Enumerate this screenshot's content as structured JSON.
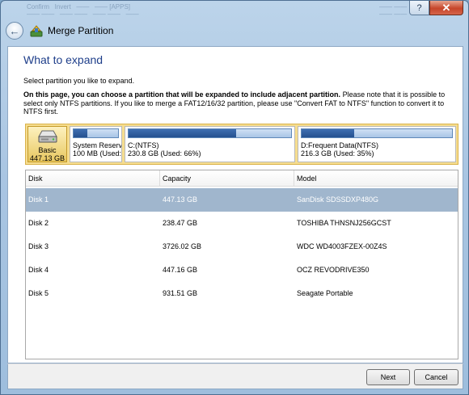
{
  "window": {
    "title": "Merge Partition",
    "bg_text_left": "Confirm   Invert   ——   —— [APPS]\n—— ——   —— ——   —— ——   ——",
    "bg_text_right": "—— ——   ——\n—— ——   ——",
    "controls": {
      "help": "?",
      "close": "✕"
    }
  },
  "page": {
    "heading": "What to expand",
    "subheading": "Select partition you like to expand.",
    "description_bold": "On this page, you can choose a partition that will be expanded to include adjacent partition.",
    "description_rest": " Please note that it is possible to select only NTFS partitions. If you like to merge a FAT12/16/32 partition, please use \"Convert FAT to NTFS\" function to convert it to NTFS first."
  },
  "disk_map": {
    "disk": {
      "type": "Basic",
      "size": "447.13 GB",
      "icon": "hard-drive-icon"
    },
    "partitions": [
      {
        "name": "System Reserv",
        "info": "100 MB (Used:",
        "used_fraction": 0.3
      },
      {
        "name": "C:(NTFS)",
        "info": "230.8 GB (Used: 66%)",
        "used_fraction": 0.66
      },
      {
        "name": "D:Frequent Data(NTFS)",
        "info": "216.3 GB (Used: 35%)",
        "used_fraction": 0.35
      }
    ]
  },
  "table": {
    "columns": [
      "Disk",
      "Capacity",
      "Model"
    ],
    "rows": [
      {
        "disk": "Disk 1",
        "capacity": "447.13 GB",
        "model": "SanDisk SDSSDXP480G",
        "selected": true
      },
      {
        "disk": "Disk 2",
        "capacity": "238.47 GB",
        "model": "TOSHIBA THNSNJ256GCST",
        "selected": false
      },
      {
        "disk": "Disk 3",
        "capacity": "3726.02 GB",
        "model": "WDC WD4003FZEX-00Z4S",
        "selected": false
      },
      {
        "disk": "Disk 4",
        "capacity": "447.16 GB",
        "model": "OCZ REVODRIVE350",
        "selected": false
      },
      {
        "disk": "Disk 5",
        "capacity": "931.51 GB",
        "model": "Seagate Portable",
        "selected": false
      }
    ]
  },
  "buttons": {
    "next": "Next",
    "cancel": "Cancel"
  },
  "colors": {
    "selection": "#a0b6cd",
    "heading": "#1e3e8a",
    "disk_strip": "#f6dd8f",
    "bar_fill": "#24508f"
  }
}
